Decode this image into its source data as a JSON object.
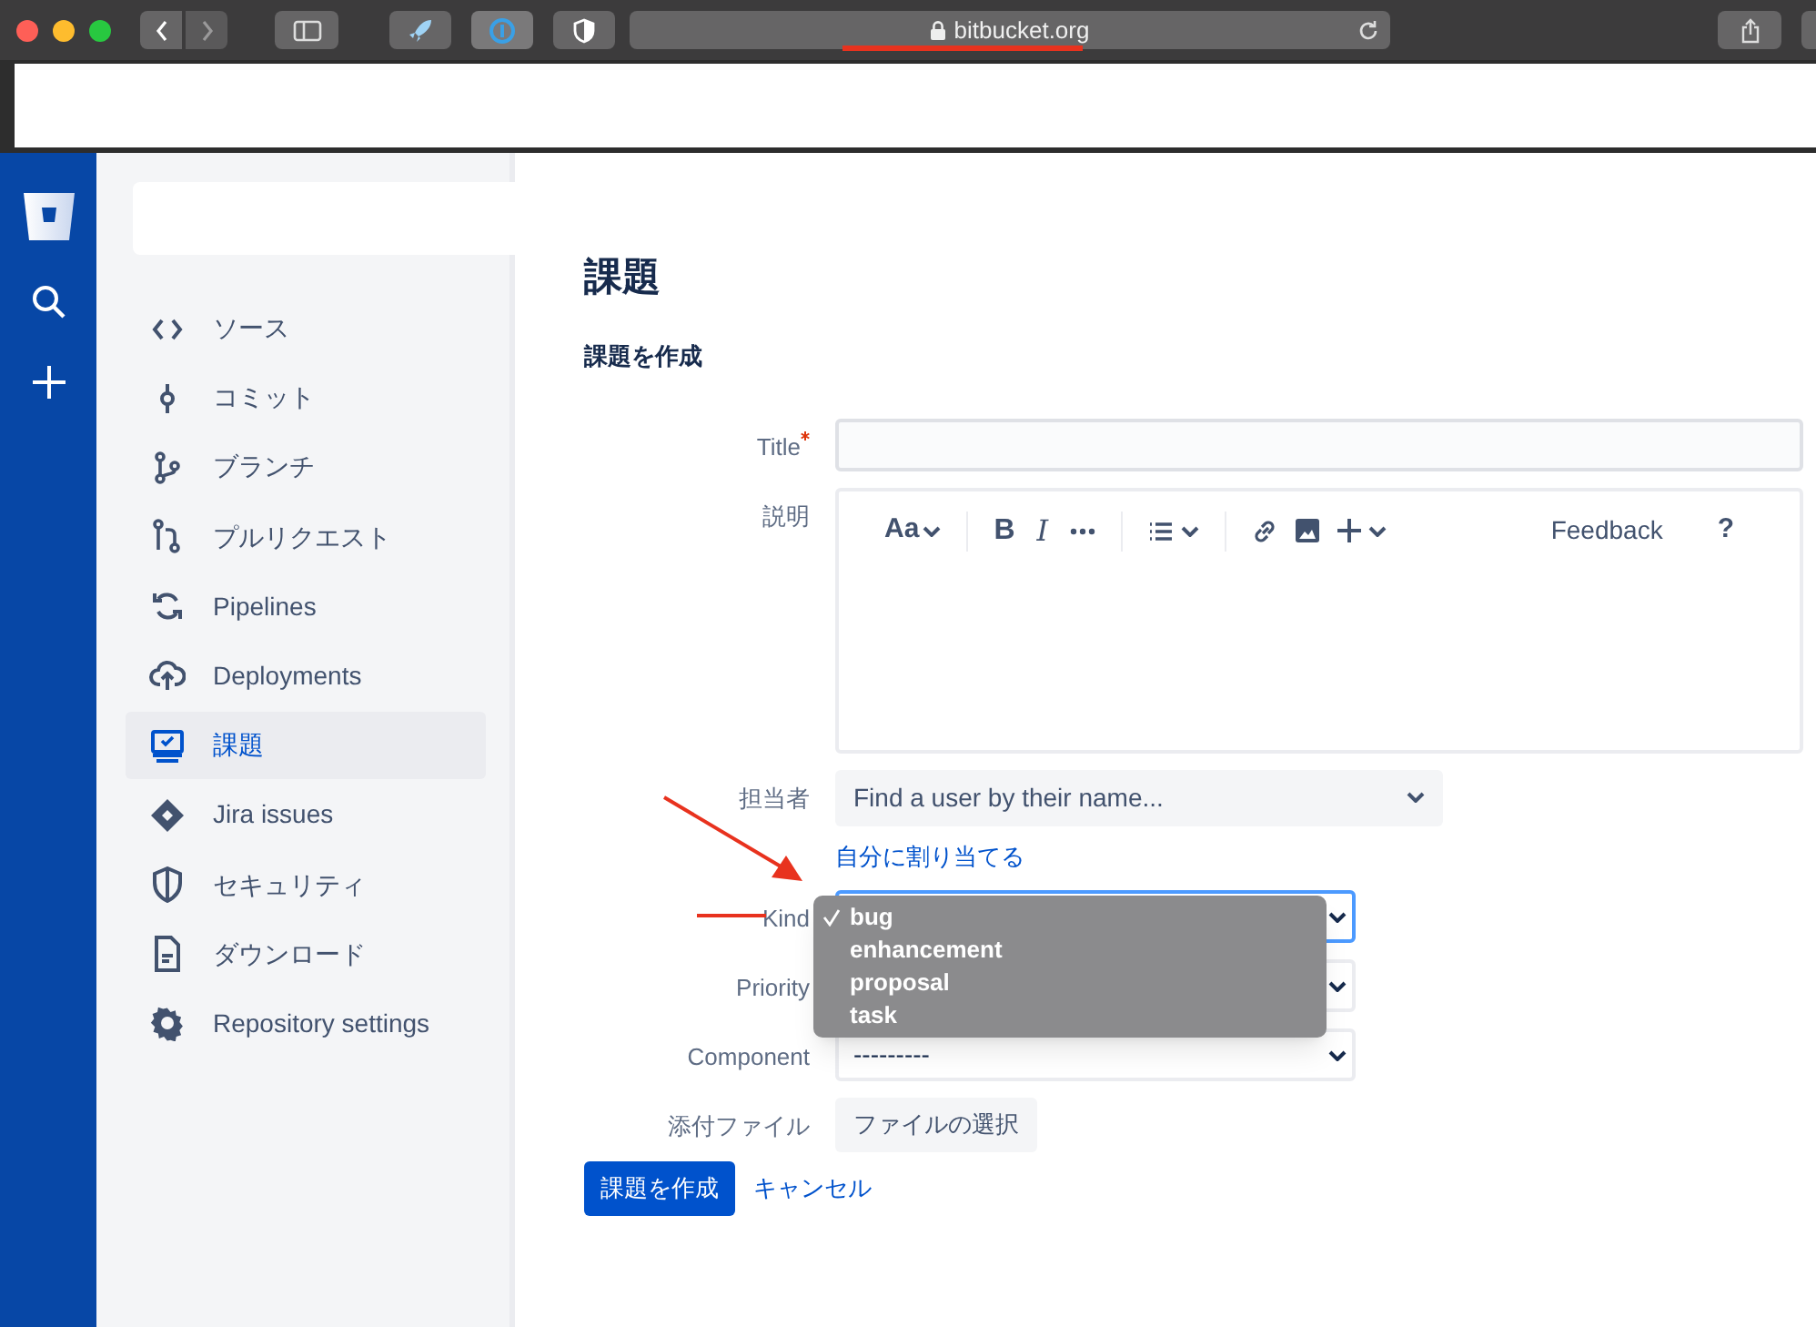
{
  "browser": {
    "url": "bitbucket.org"
  },
  "sidebar": {
    "items": [
      {
        "label": "ソース",
        "selected": false
      },
      {
        "label": "コミット",
        "selected": false
      },
      {
        "label": "ブランチ",
        "selected": false
      },
      {
        "label": "プルリクエスト",
        "selected": false
      },
      {
        "label": "Pipelines",
        "selected": false
      },
      {
        "label": "Deployments",
        "selected": false
      },
      {
        "label": "課題",
        "selected": true
      },
      {
        "label": "Jira issues",
        "selected": false
      },
      {
        "label": "セキュリティ",
        "selected": false
      },
      {
        "label": "ダウンロード",
        "selected": false
      },
      {
        "label": "Repository settings",
        "selected": false
      }
    ]
  },
  "page": {
    "title": "課題",
    "subtitle": "課題を作成"
  },
  "form": {
    "fields": [
      {
        "kind": "text",
        "label": "Title",
        "required": true
      },
      {
        "kind": "editor",
        "label": "説明",
        "toolbar": {
          "font_button": "Aa",
          "bold": "B",
          "italic": "I",
          "feedback": "Feedback",
          "help": "?"
        }
      },
      {
        "kind": "user",
        "label": "担当者",
        "placeholder": "Find a user by their name...",
        "link": "自分に割り当てる"
      },
      {
        "kind": "select",
        "label": "Kind",
        "focused": true,
        "open": true,
        "options": [
          {
            "label": "bug",
            "selected": true
          },
          {
            "label": "enhancement",
            "selected": false
          },
          {
            "label": "proposal",
            "selected": false
          },
          {
            "label": "task",
            "selected": false
          }
        ]
      },
      {
        "kind": "select",
        "label": "Priority",
        "focused": false
      },
      {
        "kind": "select",
        "label": "Component",
        "focused": false,
        "value": "---------"
      },
      {
        "kind": "file",
        "label": "添付ファイル",
        "button": "ファイルの選択"
      }
    ],
    "submit": "課題を作成",
    "cancel": "キャンセル"
  }
}
